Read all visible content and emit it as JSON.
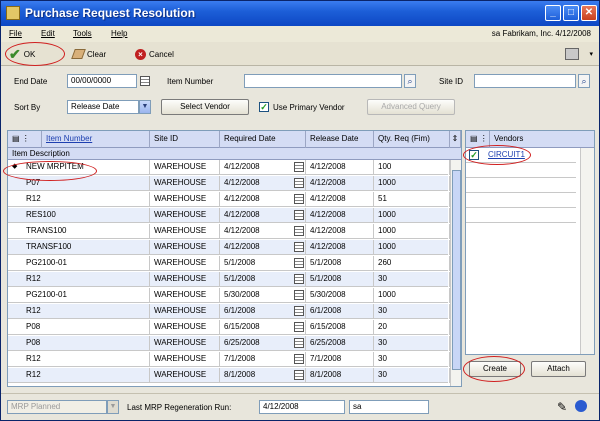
{
  "window": {
    "title": "Purchase Request Resolution",
    "minimize": "_",
    "maximize": "□",
    "close": "✕"
  },
  "menu": {
    "items": [
      "File",
      "Edit",
      "Tools",
      "Help"
    ],
    "user": "sa",
    "company": "Fabrikam, Inc.",
    "date": "4/12/2008"
  },
  "toolbar": {
    "ok": "OK",
    "clear": "Clear",
    "cancel": "Cancel",
    "help_arrow": "▾"
  },
  "form": {
    "end_date_label": "End Date",
    "end_date_value": "00/00/0000",
    "item_number_label": "Item Number",
    "item_number_value": "",
    "site_id_label": "Site ID",
    "site_id_value": "",
    "sort_by_label": "Sort By",
    "sort_by_value": "Release Date",
    "select_vendor": "Select Vendor",
    "use_primary_vendor": "Use Primary Vendor",
    "advanced_query": "Advanced Query"
  },
  "grid": {
    "columns": [
      "Item Number",
      "Site ID",
      "Required Date",
      "Release Date",
      "Qty. Req (Fim)"
    ],
    "subheader": "Item Description",
    "rows": [
      [
        "NEW MRPITEM",
        "WAREHOUSE",
        "4/12/2008",
        "4/12/2008",
        "100"
      ],
      [
        "P07",
        "WAREHOUSE",
        "4/12/2008",
        "4/12/2008",
        "1000"
      ],
      [
        "R12",
        "WAREHOUSE",
        "4/12/2008",
        "4/12/2008",
        "51"
      ],
      [
        "RES100",
        "WAREHOUSE",
        "4/12/2008",
        "4/12/2008",
        "1000"
      ],
      [
        "TRANS100",
        "WAREHOUSE",
        "4/12/2008",
        "4/12/2008",
        "1000"
      ],
      [
        "TRANSF100",
        "WAREHOUSE",
        "4/12/2008",
        "4/12/2008",
        "1000"
      ],
      [
        "PG2100-01",
        "WAREHOUSE",
        "5/1/2008",
        "5/1/2008",
        "260"
      ],
      [
        "R12",
        "WAREHOUSE",
        "5/1/2008",
        "5/1/2008",
        "30"
      ],
      [
        "PG2100-01",
        "WAREHOUSE",
        "5/30/2008",
        "5/30/2008",
        "1000"
      ],
      [
        "R12",
        "WAREHOUSE",
        "6/1/2008",
        "6/1/2008",
        "30"
      ],
      [
        "P08",
        "WAREHOUSE",
        "6/15/2008",
        "6/15/2008",
        "20"
      ],
      [
        "P08",
        "WAREHOUSE",
        "6/25/2008",
        "6/25/2008",
        "30"
      ],
      [
        "R12",
        "WAREHOUSE",
        "7/1/2008",
        "7/1/2008",
        "30"
      ],
      [
        "R12",
        "WAREHOUSE",
        "8/1/2008",
        "8/1/2008",
        "30"
      ]
    ]
  },
  "vendors": {
    "header": "Vendors",
    "items": [
      "CIRCUIT1"
    ]
  },
  "buttons": {
    "create": "Create",
    "attach": "Attach"
  },
  "status": {
    "mrp_planned": "MRP Planned",
    "last_regen_label": "Last MRP Regeneration Run:",
    "last_regen_date": "4/12/2008",
    "last_regen_user": "sa"
  }
}
